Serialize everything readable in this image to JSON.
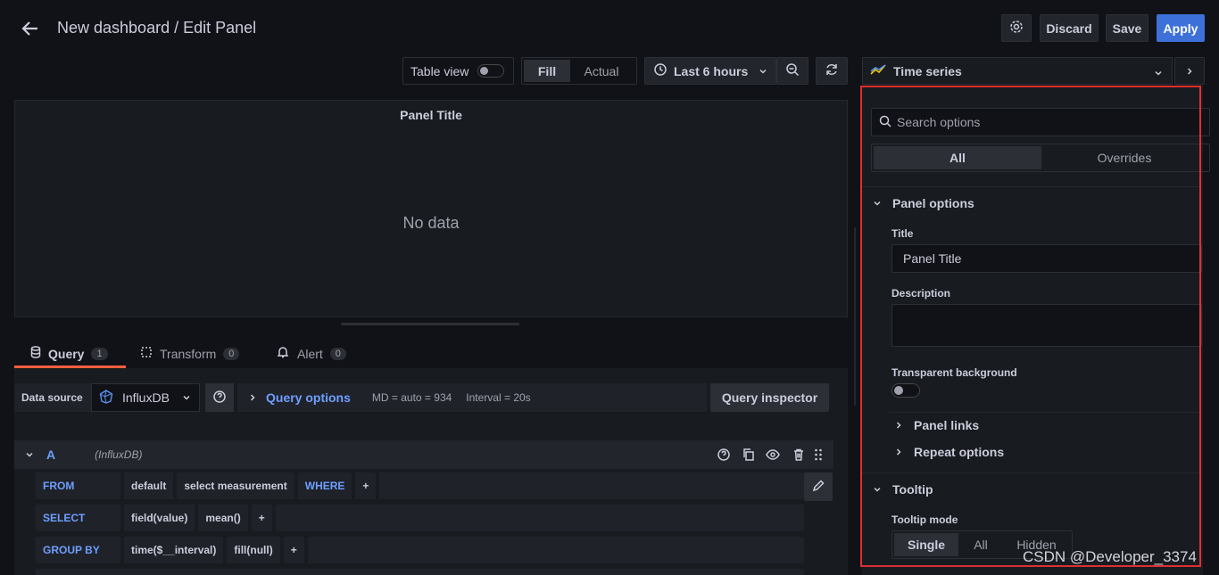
{
  "header": {
    "title": "New dashboard / Edit Panel",
    "discard_label": "Discard",
    "save_label": "Save",
    "apply_label": "Apply"
  },
  "toolbar": {
    "table_view_label": "Table view",
    "fill_label": "Fill",
    "actual_label": "Actual",
    "time_range_label": "Last 6 hours"
  },
  "viz_picker": {
    "label": "Time series"
  },
  "preview": {
    "panel_title": "Panel Title",
    "no_data": "No data"
  },
  "query_tabs": [
    {
      "label": "Query",
      "count": "1"
    },
    {
      "label": "Transform",
      "count": "0"
    },
    {
      "label": "Alert",
      "count": "0"
    }
  ],
  "datasource": {
    "label": "Data source",
    "name": "InfluxDB",
    "query_options_label": "Query options",
    "md": "MD = auto = 934",
    "interval": "Interval = 20s",
    "inspector_label": "Query inspector"
  },
  "query": {
    "ref": "A",
    "source": "(InfluxDB)",
    "from": {
      "keyword": "FROM",
      "policy": "default",
      "measurement": "select measurement",
      "where": "WHERE",
      "plus": "+"
    },
    "select": {
      "keyword": "SELECT",
      "field": "field(value)",
      "agg": "mean()",
      "plus": "+"
    },
    "group_by": {
      "keyword": "GROUP BY",
      "time": "time($__interval)",
      "fill": "fill(null)",
      "plus": "+"
    }
  },
  "options": {
    "search_placeholder": "Search options",
    "tab_all": "All",
    "tab_overrides": "Overrides",
    "panel_options_title": "Panel options",
    "title_label": "Title",
    "title_value": "Panel Title",
    "description_label": "Description",
    "transparent_label": "Transparent background",
    "panel_links_label": "Panel links",
    "repeat_options_label": "Repeat options",
    "tooltip_title": "Tooltip",
    "tooltip_mode_label": "Tooltip mode",
    "tooltip_modes": [
      "Single",
      "All",
      "Hidden"
    ]
  },
  "watermark": "CSDN @Developer_3374",
  "colors": {
    "accent": "#3d71d9",
    "highlight": "#e02f2f",
    "tab_underline": "#f55f3e"
  }
}
